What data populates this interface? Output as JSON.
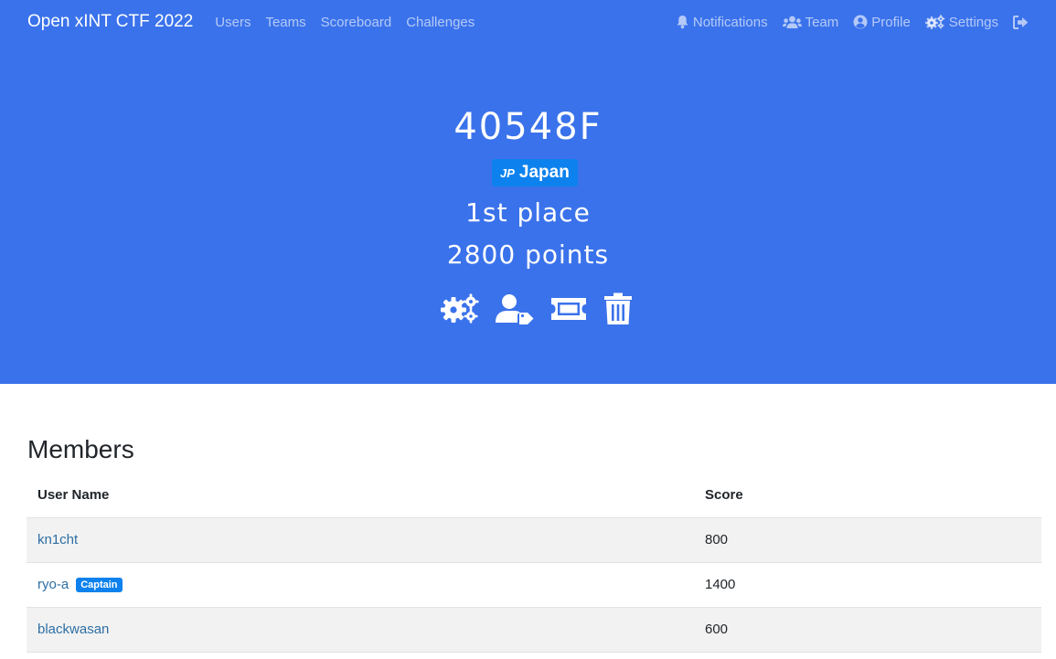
{
  "navbar": {
    "brand": "Open xINT CTF 2022",
    "left_links": [
      "Users",
      "Teams",
      "Scoreboard",
      "Challenges"
    ],
    "notifications": "Notifications",
    "team": "Team",
    "profile": "Profile",
    "settings": "Settings",
    "icons": [
      "bell-icon",
      "users-icon",
      "user-circle-icon",
      "cogs-icon",
      "sign-out-icon"
    ]
  },
  "team": {
    "name": "40548F",
    "country_code": "JP",
    "country": "Japan",
    "place_number": "1st",
    "place_word": "place",
    "points_number": "2800",
    "points_word": "points",
    "action_icons": [
      "cogs-icon",
      "user-tag-icon",
      "ticket-icon",
      "trash-icon"
    ]
  },
  "members": {
    "title": "Members",
    "columns": [
      "User Name",
      "Score"
    ],
    "rows": [
      {
        "name": "kn1cht",
        "score": "800",
        "badge": ""
      },
      {
        "name": "ryo-a",
        "score": "1400",
        "badge": "Captain"
      },
      {
        "name": "blackwasan",
        "score": "600",
        "badge": ""
      }
    ]
  },
  "colors": {
    "primary": "#3a72eb",
    "badge": "#0d82ee",
    "link": "#2d6ea3"
  }
}
